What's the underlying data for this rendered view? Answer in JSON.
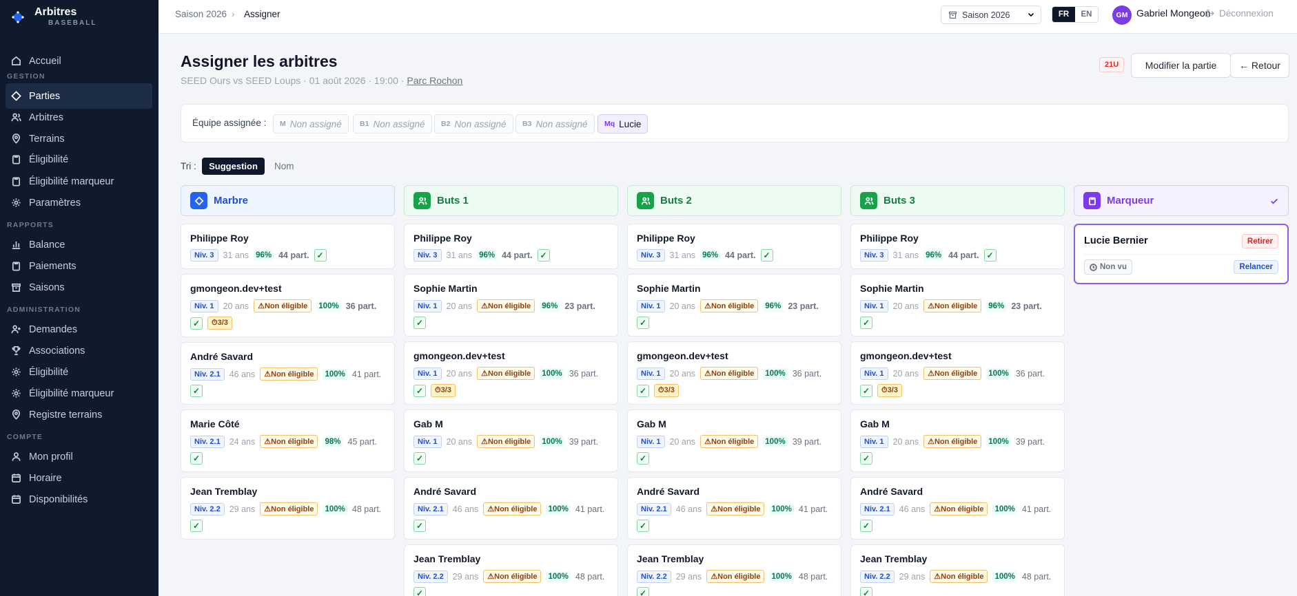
{
  "app": {
    "title": "Arbitres",
    "subtitle": "BASEBALL"
  },
  "sidebar": {
    "items": [
      {
        "label": "Accueil",
        "icon": "home-icon"
      },
      {
        "label": "Parties",
        "icon": "diamond-icon",
        "active": true
      },
      {
        "label": "Arbitres",
        "icon": "users-icon"
      },
      {
        "label": "Terrains",
        "icon": "map-pin-icon"
      },
      {
        "label": "Éligibilité",
        "icon": "clipboard-icon"
      },
      {
        "label": "Éligibilité marqueur",
        "icon": "clipboard-icon"
      },
      {
        "label": "Paramètres",
        "icon": "gear-icon"
      },
      {
        "label": "Balance",
        "icon": "bar-chart-icon"
      },
      {
        "label": "Paiements",
        "icon": "clipboard-icon"
      },
      {
        "label": "Saisons",
        "icon": "archive-icon"
      },
      {
        "label": "Demandes",
        "icon": "user-plus-icon"
      },
      {
        "label": "Associations",
        "icon": "trophy-icon"
      },
      {
        "label": "Éligibilité",
        "icon": "gear-icon"
      },
      {
        "label": "Éligibilité marqueur",
        "icon": "gear-icon"
      },
      {
        "label": "Registre terrains",
        "icon": "map-pin-icon"
      },
      {
        "label": "Mon profil",
        "icon": "user-icon"
      },
      {
        "label": "Horaire",
        "icon": "calendar-icon"
      },
      {
        "label": "Disponibilités",
        "icon": "calendar-icon"
      }
    ],
    "sections": {
      "gestion": "GESTION",
      "rapports": "RAPPORTS",
      "administration": "ADMINISTRATION",
      "compte": "COMPTE"
    }
  },
  "topbar": {
    "breadcrumb": [
      "Saison 2026",
      "Assigner"
    ],
    "season": "Saison 2026",
    "lang_fr": "FR",
    "lang_en": "EN",
    "user_initials": "GM",
    "user_name": "Gabriel Mongeon",
    "logout": "Déconnexion"
  },
  "page": {
    "title": "Assigner les arbitres",
    "subtitle": "SEED Ours vs SEED Loups · 01 août 2026 · 19:00 · ",
    "venue": "Parc Rochon",
    "category_badge": "21U",
    "edit_button": "Modifier la partie",
    "back_button": "← Retour"
  },
  "team": {
    "label": "Équipe assignée :",
    "slots": [
      {
        "code": "M",
        "value": "Non assigné"
      },
      {
        "code": "B1",
        "value": "Non assigné"
      },
      {
        "code": "B2",
        "value": "Non assigné"
      },
      {
        "code": "B3",
        "value": "Non assigné"
      },
      {
        "code": "Mq",
        "value": "Lucie"
      }
    ]
  },
  "sort": {
    "label": "Tri :",
    "options": [
      "Suggestion",
      "Nom"
    ],
    "selected": "Suggestion"
  },
  "colors": {
    "accent_blue": "#2563eb",
    "accent_green": "#16a34a",
    "accent_purple": "#7c3aed",
    "sidebar_bg": "#0f1b2d"
  },
  "columns": [
    {
      "title": "Marbre",
      "theme": "blue",
      "icon": "diamond-icon",
      "cards": [
        {
          "name": "Philippe Roy",
          "level": "Niv. 3",
          "age": "31 ans",
          "pct": "96%",
          "parts": "44 part.",
          "bold": true
        },
        {
          "name": "gmongeon.dev+test",
          "level": "Niv. 1",
          "age": "20 ans",
          "warn": "Non éligible",
          "pct": "100%",
          "parts": "36 part.",
          "bold": true,
          "count": "3/3"
        },
        {
          "name": "André Savard",
          "level": "Niv. 2.1",
          "age": "46 ans",
          "warn": "Non éligible",
          "pct": "100%",
          "parts": "41 part."
        },
        {
          "name": "Marie Côté",
          "level": "Niv. 2.1",
          "age": "24 ans",
          "warn": "Non éligible",
          "pct": "98%",
          "parts": "45 part."
        },
        {
          "name": "Jean Tremblay",
          "level": "Niv. 2.2",
          "age": "29 ans",
          "warn": "Non éligible",
          "pct": "100%",
          "parts": "48 part."
        }
      ]
    },
    {
      "title": "Buts 1",
      "theme": "green",
      "icon": "users-icon",
      "cards": [
        {
          "name": "Philippe Roy",
          "level": "Niv. 3",
          "age": "31 ans",
          "pct": "96%",
          "parts": "44 part.",
          "bold": true
        },
        {
          "name": "Sophie Martin",
          "level": "Niv. 1",
          "age": "20 ans",
          "warn": "Non éligible",
          "pct": "96%",
          "parts": "23 part.",
          "bold": true
        },
        {
          "name": "gmongeon.dev+test",
          "level": "Niv. 1",
          "age": "20 ans",
          "warn": "Non éligible",
          "pct": "100%",
          "parts": "36 part.",
          "count": "3/3"
        },
        {
          "name": "Gab M",
          "level": "Niv. 1",
          "age": "20 ans",
          "warn": "Non éligible",
          "pct": "100%",
          "parts": "39 part."
        },
        {
          "name": "André Savard",
          "level": "Niv. 2.1",
          "age": "46 ans",
          "warn": "Non éligible",
          "pct": "100%",
          "parts": "41 part."
        },
        {
          "name": "Jean Tremblay",
          "level": "Niv. 2.2",
          "age": "29 ans",
          "warn": "Non éligible",
          "pct": "100%",
          "parts": "48 part."
        }
      ]
    },
    {
      "title": "Buts 2",
      "theme": "green",
      "icon": "users-icon",
      "cards": [
        {
          "name": "Philippe Roy",
          "level": "Niv. 3",
          "age": "31 ans",
          "pct": "96%",
          "parts": "44 part.",
          "bold": true
        },
        {
          "name": "Sophie Martin",
          "level": "Niv. 1",
          "age": "20 ans",
          "warn": "Non éligible",
          "pct": "96%",
          "parts": "23 part.",
          "bold": true
        },
        {
          "name": "gmongeon.dev+test",
          "level": "Niv. 1",
          "age": "20 ans",
          "warn": "Non éligible",
          "pct": "100%",
          "parts": "36 part.",
          "count": "3/3"
        },
        {
          "name": "Gab M",
          "level": "Niv. 1",
          "age": "20 ans",
          "warn": "Non éligible",
          "pct": "100%",
          "parts": "39 part."
        },
        {
          "name": "André Savard",
          "level": "Niv. 2.1",
          "age": "46 ans",
          "warn": "Non éligible",
          "pct": "100%",
          "parts": "41 part."
        },
        {
          "name": "Jean Tremblay",
          "level": "Niv. 2.2",
          "age": "29 ans",
          "warn": "Non éligible",
          "pct": "100%",
          "parts": "48 part."
        }
      ]
    },
    {
      "title": "Buts 3",
      "theme": "green",
      "icon": "users-icon",
      "cards": [
        {
          "name": "Philippe Roy",
          "level": "Niv. 3",
          "age": "31 ans",
          "pct": "96%",
          "parts": "44 part.",
          "bold": true
        },
        {
          "name": "Sophie Martin",
          "level": "Niv. 1",
          "age": "20 ans",
          "warn": "Non éligible",
          "pct": "96%",
          "parts": "23 part.",
          "bold": true
        },
        {
          "name": "gmongeon.dev+test",
          "level": "Niv. 1",
          "age": "20 ans",
          "warn": "Non éligible",
          "pct": "100%",
          "parts": "36 part.",
          "count": "3/3"
        },
        {
          "name": "Gab M",
          "level": "Niv. 1",
          "age": "20 ans",
          "warn": "Non éligible",
          "pct": "100%",
          "parts": "39 part."
        },
        {
          "name": "André Savard",
          "level": "Niv. 2.1",
          "age": "46 ans",
          "warn": "Non éligible",
          "pct": "100%",
          "parts": "41 part."
        },
        {
          "name": "Jean Tremblay",
          "level": "Niv. 2.2",
          "age": "29 ans",
          "warn": "Non éligible",
          "pct": "100%",
          "parts": "48 part."
        }
      ]
    }
  ],
  "marqueur": {
    "title": "Marqueur",
    "assigned_name": "Lucie Bernier",
    "remove": "Retirer",
    "status": "Non vu",
    "remind": "Relancer"
  }
}
